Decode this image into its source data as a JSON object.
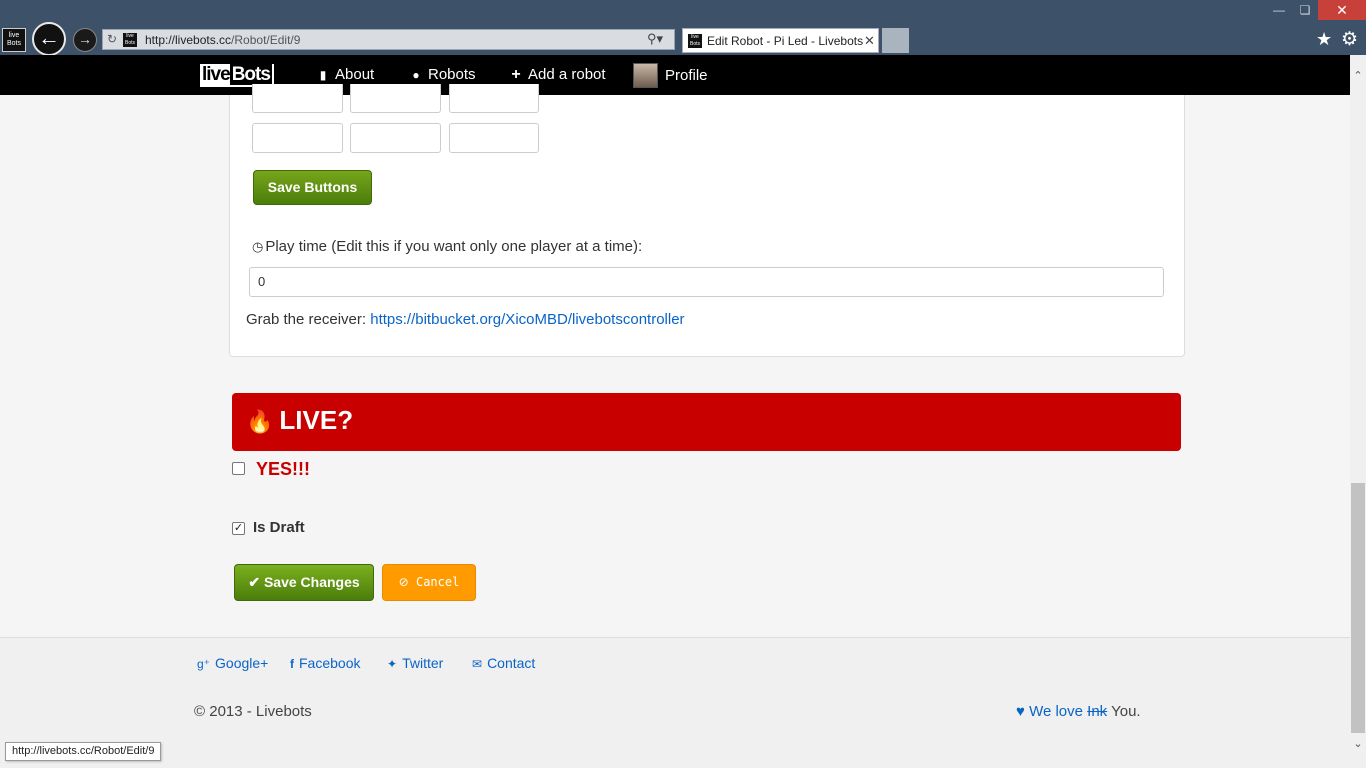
{
  "browser": {
    "url_host": "http://livebots.cc",
    "url_path": "/Robot/Edit/9",
    "tab_title": "Edit Robot - Pi Led - Livebots",
    "favicon_text": "live Bots",
    "icons": [
      "back-arrow-icon",
      "forward-arrow-icon",
      "refresh-icon",
      "search-icon",
      "close-icon",
      "star-icon",
      "gear-icon"
    ],
    "window_buttons": {
      "minimize": "—",
      "maximize": "❏",
      "close": "✕"
    }
  },
  "navbar": {
    "brand_part1": "live",
    "brand_part2": "Bots",
    "items": [
      {
        "label": "About",
        "icon": "bookmark-icon"
      },
      {
        "label": "Robots",
        "icon": "globe-icon"
      },
      {
        "label": "Add a robot",
        "icon": "plus-icon"
      },
      {
        "label": "Profile",
        "icon": "avatar"
      }
    ]
  },
  "form": {
    "save_buttons_label": "Save Buttons",
    "play_time_label": "Play time (Edit this if you want only one player at a time):",
    "play_time_value": "0",
    "grab_label": "Grab the receiver:",
    "grab_link": "https://bitbucket.org/XicoMBD/livebotscontroller",
    "live_title": "LIVE?",
    "yes_label": "YES!!!",
    "yes_checked": false,
    "draft_label": "Is Draft",
    "draft_checked": true,
    "save_changes_label": "Save Changes",
    "cancel_label": "Cancel"
  },
  "footer": {
    "links": [
      {
        "label": "Google+",
        "icon": "google-plus-icon"
      },
      {
        "label": "Facebook",
        "icon": "facebook-icon"
      },
      {
        "label": "Twitter",
        "icon": "twitter-icon"
      },
      {
        "label": "Contact",
        "icon": "envelope-icon"
      }
    ],
    "copyright": "2013 - Livebots",
    "love_prefix": "We love",
    "love_struck": "Ink",
    "love_suffix": "You."
  },
  "status_bar_url": "http://livebots.cc/Robot/Edit/9",
  "colors": {
    "live_red": "#c80000",
    "save_green": "#5a8f12",
    "cancel_orange": "#ff9b00",
    "link_blue": "#0a64c8",
    "chrome_blue": "#3d5268"
  }
}
